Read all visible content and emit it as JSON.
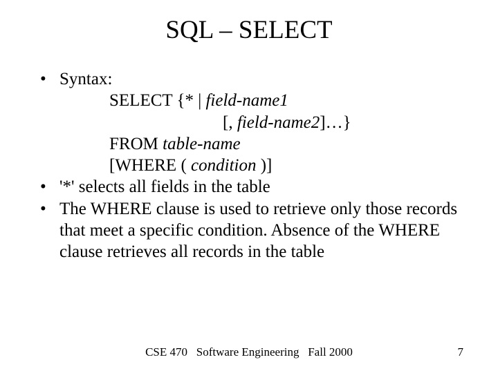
{
  "title": "SQL – SELECT",
  "bullets": {
    "b1": "Syntax:",
    "b1_line1_pre": "SELECT {* | ",
    "b1_line1_it": "field-name1",
    "b1_line2_pre": "[, ",
    "b1_line2_it": "field-name2",
    "b1_line2_post": "]…}",
    "b1_line3_pre": "FROM ",
    "b1_line3_it": "table-name",
    "b1_line4_pre": "[WHERE ( ",
    "b1_line4_it": "condition",
    "b1_line4_post": " )]",
    "b2": "'*' selects all fields in the table",
    "b3": "The WHERE clause is used to retrieve only those records that meet a specific condition.  Absence of the WHERE clause retrieves all records in the table"
  },
  "footer": {
    "course": "CSE 470",
    "name": "Software Engineering",
    "term": "Fall 2000"
  },
  "pagenum": "7"
}
